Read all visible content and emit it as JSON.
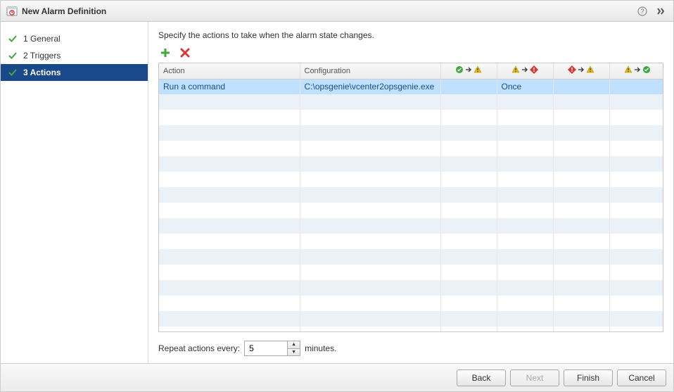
{
  "titlebar": {
    "title": "New Alarm Definition"
  },
  "sidebar": {
    "steps": [
      {
        "label": "1  General"
      },
      {
        "label": "2  Triggers"
      },
      {
        "label": "3  Actions"
      }
    ]
  },
  "main": {
    "instruction": "Specify the actions to take when the alarm state changes.",
    "headers": {
      "action": "Action",
      "config": "Configuration"
    },
    "rows": [
      {
        "action": "Run a command",
        "config": "C:\\opsgenie\\vcenter2opsgenie.exe",
        "s1": "",
        "s2": "Once",
        "s3": "",
        "s4": ""
      }
    ],
    "empty_row_count": 16,
    "repeat": {
      "label_before": "Repeat actions every:",
      "value": "5",
      "label_after": "minutes."
    }
  },
  "footer": {
    "back": "Back",
    "next": "Next",
    "finish": "Finish",
    "cancel": "Cancel"
  },
  "icons": {
    "ok_color": "#3fa93f",
    "warn_color": "#e6b800",
    "crit_color": "#d93636",
    "arrow_color": "#333"
  }
}
